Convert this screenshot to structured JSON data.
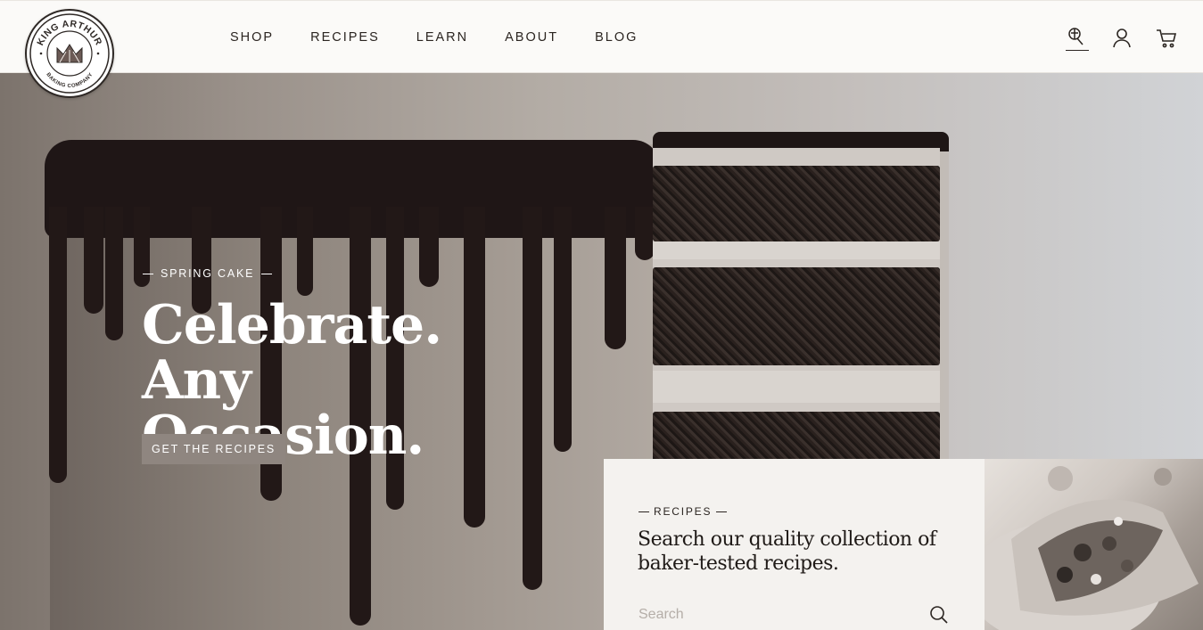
{
  "brand": {
    "name_top": "KING ARTHUR",
    "name_bottom": "BAKING COMPANY"
  },
  "nav": {
    "items": [
      {
        "label": "SHOP"
      },
      {
        "label": "RECIPES"
      },
      {
        "label": "LEARN"
      },
      {
        "label": "ABOUT"
      },
      {
        "label": "BLOG"
      }
    ]
  },
  "header_icons": [
    "chef-hat-icon",
    "user-icon",
    "cart-icon"
  ],
  "hero": {
    "eyebrow": "SPRING CAKE",
    "title_line1": "Celebrate. Any",
    "title_line2": "Occasion.",
    "button_label": "GET THE RECIPES"
  },
  "recipes_panel": {
    "eyebrow": "RECIPES",
    "title_line1": "Search our quality collection of",
    "title_line2": "baker-tested recipes.",
    "search_placeholder": "Search"
  },
  "colors": {
    "header_bg": "#fbfaf8",
    "text_dark": "#2b2521",
    "hero_button_bg": "#8f8680",
    "panel_bg": "#f4f2ef"
  }
}
